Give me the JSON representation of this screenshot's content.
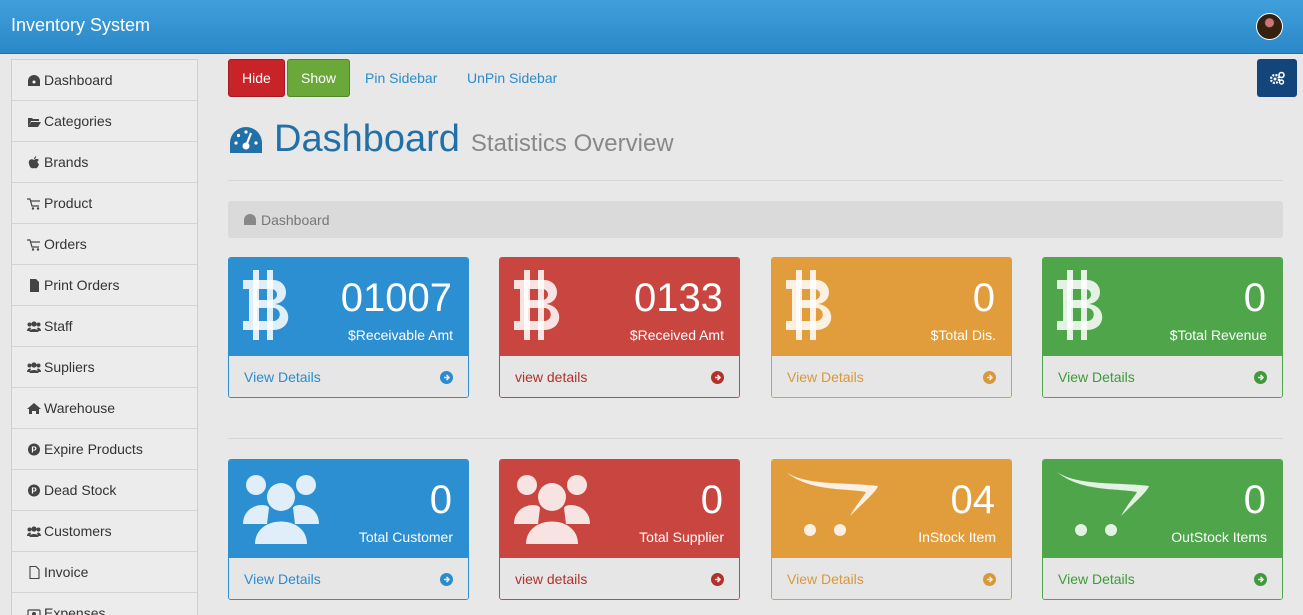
{
  "app": {
    "title": "Inventory System"
  },
  "sidebar": {
    "items": [
      {
        "label": "Dashboard",
        "icon": "dashboard-icon"
      },
      {
        "label": "Categories",
        "icon": "folder-icon"
      },
      {
        "label": "Brands",
        "icon": "apple-icon"
      },
      {
        "label": "Product",
        "icon": "cart-icon"
      },
      {
        "label": "Orders",
        "icon": "cart-icon"
      },
      {
        "label": "Print Orders",
        "icon": "file-icon"
      },
      {
        "label": "Staff",
        "icon": "users-icon"
      },
      {
        "label": "Supliers",
        "icon": "users-icon"
      },
      {
        "label": "Warehouse",
        "icon": "home-icon"
      },
      {
        "label": "Expire Products",
        "icon": "product-hunt-icon"
      },
      {
        "label": "Dead Stock",
        "icon": "product-hunt-icon"
      },
      {
        "label": "Customers",
        "icon": "users-icon"
      },
      {
        "label": "Invoice",
        "icon": "file-outline-icon"
      },
      {
        "label": "Expenses",
        "icon": "money-icon"
      }
    ]
  },
  "toolbar": {
    "hide_label": "Hide",
    "show_label": "Show",
    "pin_label": "Pin Sidebar",
    "unpin_label": "UnPin Sidebar"
  },
  "header": {
    "title": "Dashboard",
    "subtitle": "Statistics Overview"
  },
  "breadcrumb": {
    "label": "Dashboard"
  },
  "colors": {
    "blue": "#2b8fd2",
    "red": "#c9453f",
    "orange": "#e19d3b",
    "green": "#4ea54a"
  },
  "cards": [
    {
      "value": "01007",
      "label": "$Receivable Amt",
      "link": "View Details",
      "color": "blue",
      "icon": "bitcoin-icon"
    },
    {
      "value": "0133",
      "label": "$Received Amt",
      "link": "view details",
      "color": "red",
      "icon": "bitcoin-icon"
    },
    {
      "value": "0",
      "label": "$Total Dis.",
      "link": "View Details",
      "color": "orange",
      "icon": "bitcoin-icon"
    },
    {
      "value": "0",
      "label": "$Total Revenue",
      "link": "View Details",
      "color": "green",
      "icon": "bitcoin-icon"
    },
    {
      "value": "0",
      "label": "Total Customer",
      "link": "View Details",
      "color": "blue",
      "icon": "users-icon"
    },
    {
      "value": "0",
      "label": "Total Supplier",
      "link": "view details",
      "color": "red",
      "icon": "users-icon"
    },
    {
      "value": "04",
      "label": "InStock Item",
      "link": "View Details",
      "color": "orange",
      "icon": "opencart-icon"
    },
    {
      "value": "0",
      "label": "OutStock Items",
      "link": "View Details",
      "color": "green",
      "icon": "opencart-icon"
    }
  ]
}
